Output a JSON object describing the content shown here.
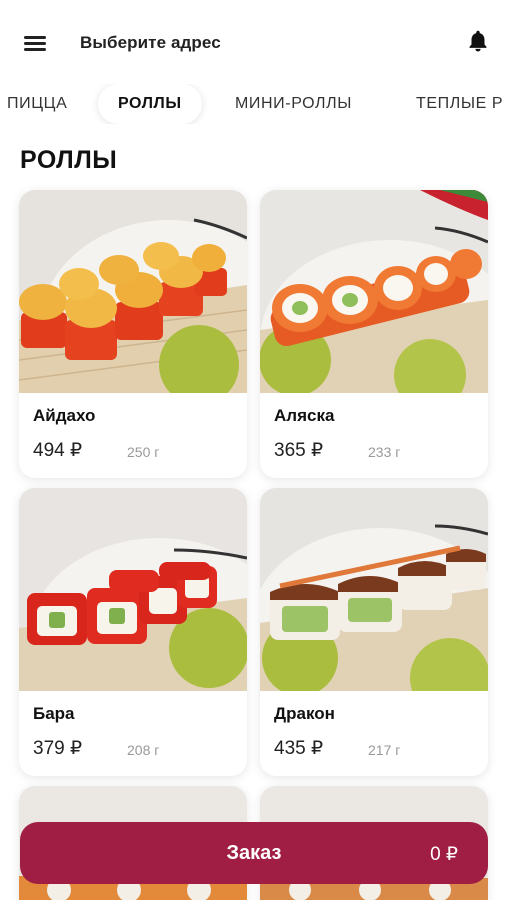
{
  "header": {
    "address_prompt": "Выберите адрес",
    "menu_icon": "menu-icon",
    "bell_icon": "bell-icon"
  },
  "tabs": [
    {
      "label": "ПИЦЦА",
      "active": false
    },
    {
      "label": "РОЛЛЫ",
      "active": true
    },
    {
      "label": "МИНИ-РОЛЛЫ",
      "active": false
    },
    {
      "label": "ТЕПЛЫЕ Р",
      "active": false
    }
  ],
  "section_title": "РОЛЛЫ",
  "products": [
    {
      "name": "Айдахо",
      "price": "494 ₽",
      "weight": "250 г"
    },
    {
      "name": "Аляска",
      "price": "365 ₽",
      "weight": "233 г"
    },
    {
      "name": "Бара",
      "price": "379 ₽",
      "weight": "208 г"
    },
    {
      "name": "Дракон",
      "price": "435 ₽",
      "weight": "217 г"
    }
  ],
  "order_bar": {
    "label": "Заказ",
    "total": "0 ₽"
  },
  "colors": {
    "accent": "#a01d43",
    "text": "#111111",
    "muted": "#999999"
  }
}
